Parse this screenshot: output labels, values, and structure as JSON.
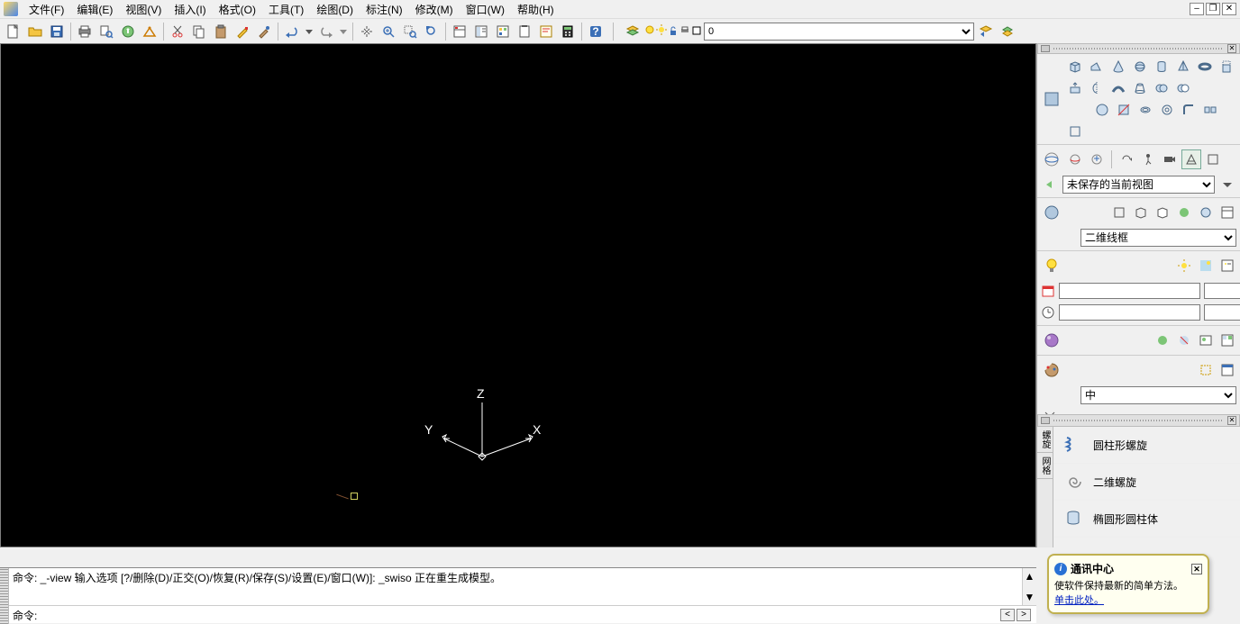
{
  "menu": {
    "file": "文件(F)",
    "edit": "编辑(E)",
    "view": "视图(V)",
    "insert": "插入(I)",
    "format": "格式(O)",
    "tools": "工具(T)",
    "draw": "绘图(D)",
    "dimension": "标注(N)",
    "modify": "修改(M)",
    "window": "窗口(W)",
    "help": "帮助(H)"
  },
  "layer": {
    "current": "0"
  },
  "right": {
    "view_combo": "未保存的当前视图",
    "visual_style_combo": "二维线框",
    "material_combo": "中"
  },
  "palette": {
    "tab1": "螺旋",
    "tab2": "网格",
    "item1": "圆柱形螺旋",
    "item2": "二维螺旋",
    "item3": "椭圆形圆柱体"
  },
  "cmd": {
    "history": "命令: _-view 输入选项 [?/删除(D)/正交(O)/恢复(R)/保存(S)/设置(E)/窗口(W)]: _swiso 正在重生成模型。",
    "prompt": "命令:"
  },
  "balloon": {
    "title": "通讯中心",
    "text": "使软件保持最新的简单方法。",
    "link": "单击此处。"
  },
  "axis": {
    "x": "X",
    "y": "Y",
    "z": "Z"
  }
}
